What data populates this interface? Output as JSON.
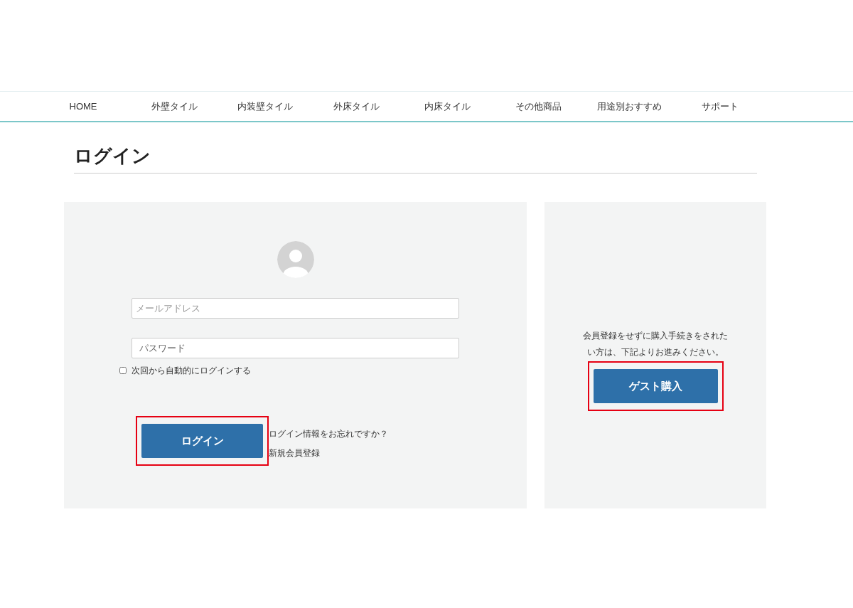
{
  "nav": [
    {
      "label": "HOME"
    },
    {
      "label": "外壁タイル"
    },
    {
      "label": "内装壁タイル"
    },
    {
      "label": "外床タイル"
    },
    {
      "label": "内床タイル"
    },
    {
      "label": "その他商品"
    },
    {
      "label": "用途別おすすめ"
    },
    {
      "label": "サポート"
    }
  ],
  "page_title": "ログイン",
  "login": {
    "email": {
      "placeholder": "メールアドレス"
    },
    "password": {
      "placeholder": "パスワード"
    },
    "remember": {
      "label": "次回から自動的にログインする",
      "checked": false
    },
    "button": {
      "label": "ログイン",
      "highlighted": true
    },
    "links": [
      "ログイン情報をお忘れですか？",
      "新規会員登録"
    ]
  },
  "guest": {
    "text": "会員登録をせずに購入手続きをされたい方は、下記よりお進みください。",
    "button": {
      "label": "ゲスト購入",
      "highlighted": true
    }
  }
}
